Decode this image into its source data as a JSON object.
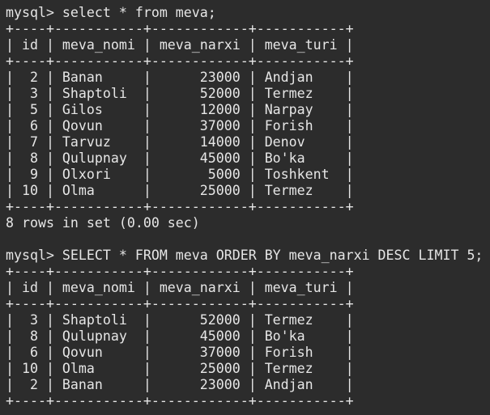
{
  "terminal": {
    "lines": [
      "mysql> select * from meva;",
      "+----+-----------+------------+-----------+",
      "| id | meva_nomi | meva_narxi | meva_turi |",
      "+----+-----------+------------+-----------+",
      "|  2 | Banan     |      23000 | Andjan    |",
      "|  3 | Shaptoli  |      52000 | Termez    |",
      "|  5 | Gilos     |      12000 | Narpay    |",
      "|  6 | Qovun     |      37000 | Forish    |",
      "|  7 | Tarvuz    |      14000 | Denov     |",
      "|  8 | Qulupnay  |      45000 | Bo'ka     |",
      "|  9 | Olxori    |       5000 | Toshkent  |",
      "| 10 | Olma      |      25000 | Termez    |",
      "+----+-----------+------------+-----------+",
      "8 rows in set (0.00 sec)",
      "",
      "mysql> SELECT * FROM meva ORDER BY meva_narxi DESC LIMIT 5;",
      "+----+-----------+------------+-----------+",
      "| id | meva_nomi | meva_narxi | meva_turi |",
      "+----+-----------+------------+-----------+",
      "|  3 | Shaptoli  |      52000 | Termez    |",
      "|  8 | Qulupnay  |      45000 | Bo'ka     |",
      "|  6 | Qovun     |      37000 | Forish    |",
      "| 10 | Olma      |      25000 | Termez    |",
      "|  2 | Banan     |      23000 | Andjan    |",
      "+----+-----------+------------+-----------+"
    ]
  }
}
